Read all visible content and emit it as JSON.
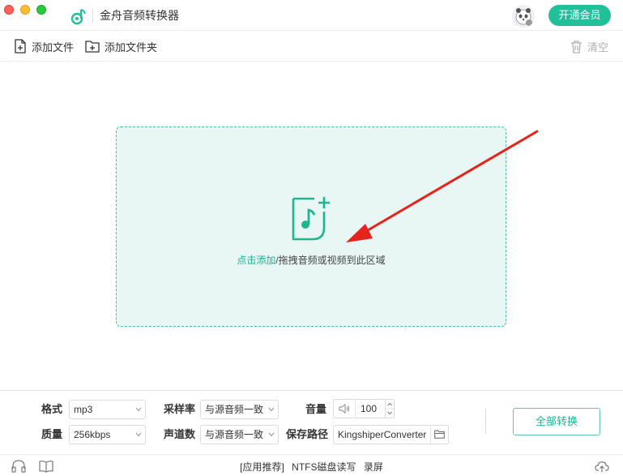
{
  "window": {
    "title": "金舟音频转换器",
    "vip_button": "开通会员"
  },
  "toolbar": {
    "add_file": "添加文件",
    "add_folder": "添加文件夹",
    "clear": "清空"
  },
  "drop_zone": {
    "link_text": "点击添加",
    "rest_text": "/拖拽音频或视频到此区域"
  },
  "settings": {
    "format_label": "格式",
    "format_value": "mp3",
    "quality_label": "质量",
    "quality_value": "256kbps",
    "sample_rate_label": "采样率",
    "sample_rate_value": "与源音频一致",
    "channels_label": "声道数",
    "channels_value": "与源音频一致",
    "volume_label": "音量",
    "volume_value": "100",
    "save_path_label": "保存路径",
    "save_path_value": "KingshiperConverter",
    "convert_all": "全部转换"
  },
  "footer": {
    "app_recommend": "[应用推荐]",
    "ntfs": "NTFS磁盘读写",
    "screen_record": "录屏"
  },
  "colors": {
    "accent": "#22c09a",
    "drop_bg": "#e8f7f4",
    "drop_border": "#4cbca5",
    "arrow": "#e8231b"
  },
  "icons": [
    "app-logo-icon",
    "add-file-icon",
    "add-folder-icon",
    "trash-icon",
    "music-file-plus-icon",
    "volume-icon",
    "folder-icon",
    "headphone-icon",
    "book-icon",
    "cloud-upload-icon"
  ]
}
